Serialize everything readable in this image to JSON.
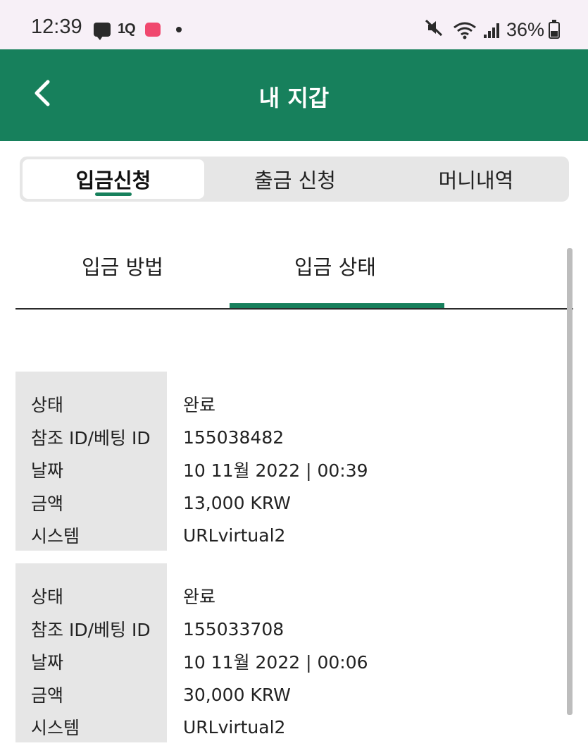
{
  "status_bar": {
    "time": "12:39",
    "app_badge": "1Q",
    "battery": "36%",
    "icons": [
      "chat-icon",
      "onestore-icon",
      "grip-app-icon",
      "dot-icon",
      "mute-icon",
      "wifi-icon",
      "signal-icon",
      "battery-icon"
    ]
  },
  "header": {
    "title": "내 지갑",
    "back_icon": "chevron-left-icon",
    "color": "#17805c"
  },
  "segment_tabs": [
    {
      "label": "입금신청",
      "active": true
    },
    {
      "label": "출금 신청",
      "active": false
    },
    {
      "label": "머니내역",
      "active": false
    }
  ],
  "sub_tabs": [
    {
      "label": "입금 방법",
      "active": false
    },
    {
      "label": "입금 상태",
      "active": true
    }
  ],
  "records": [
    {
      "rows": [
        {
          "label": "상태",
          "value": "완료"
        },
        {
          "label": "참조 ID/베팅 ID",
          "value": "155038482"
        },
        {
          "label": "날짜",
          "value": "10 11월 2022 | 00:39"
        },
        {
          "label": "금액",
          "value": "13,000 KRW"
        },
        {
          "label": "시스템",
          "value": "URLvirtual2"
        }
      ]
    },
    {
      "rows": [
        {
          "label": "상태",
          "value": "완료"
        },
        {
          "label": "참조 ID/베팅 ID",
          "value": "155033708"
        },
        {
          "label": "날짜",
          "value": "10 11월 2022 | 00:06"
        },
        {
          "label": "금액",
          "value": "30,000 KRW"
        },
        {
          "label": "시스템",
          "value": "URLvirtual2"
        }
      ]
    }
  ]
}
